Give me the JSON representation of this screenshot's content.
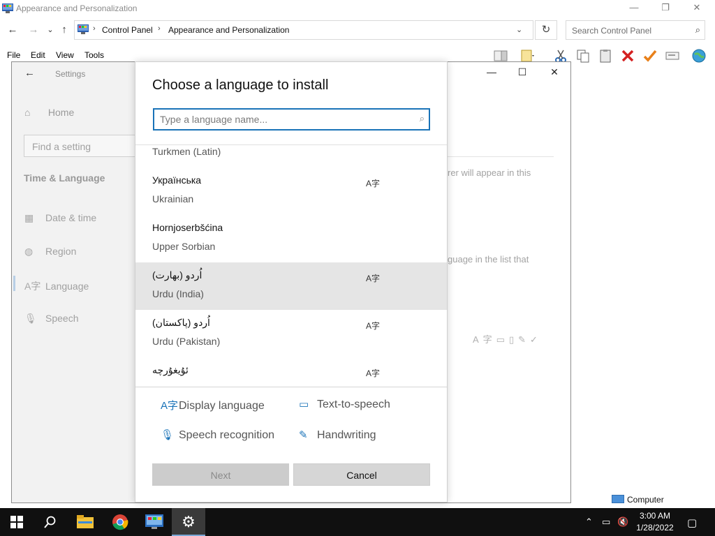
{
  "explorer": {
    "title": "Appearance and Personalization",
    "window_buttons": [
      "—",
      "❐",
      "✕"
    ],
    "nav": {
      "back": "←",
      "forward": "→",
      "recent": "⌄",
      "up": "↑"
    },
    "breadcrumb": [
      "Control Panel",
      "Appearance and Personalization"
    ],
    "breadcrumb_sep": "›",
    "address_dropdown": "⌄",
    "refresh": "↻",
    "search_placeholder": "Search Control Panel",
    "menu": [
      "File",
      "Edit",
      "View",
      "Tools"
    ]
  },
  "settings": {
    "title": "Settings",
    "back": "←",
    "home": "Home",
    "find_placeholder": "Find a setting",
    "section": "Time & Language",
    "nav": [
      {
        "label": "Date & time",
        "icon": "calendar-icon"
      },
      {
        "label": "Region",
        "icon": "globe-icon"
      },
      {
        "label": "Language",
        "icon": "language-icon"
      },
      {
        "label": "Speech",
        "icon": "microphone-icon"
      }
    ],
    "window_buttons": [
      "—",
      "☐",
      "✕"
    ],
    "bg_text_1": "rer will appear in this",
    "bg_text_2": "guage in the list that"
  },
  "dialog": {
    "title": "Choose a language to install",
    "search_placeholder": "Type a language name...",
    "languages": [
      {
        "native": "",
        "english": "Turkmen (Latin)",
        "display_language": false,
        "selected": false
      },
      {
        "native": "Українська",
        "english": "Ukrainian",
        "display_language": true,
        "selected": false
      },
      {
        "native": "Hornjoserbšćina",
        "english": "Upper Sorbian",
        "display_language": false,
        "selected": false
      },
      {
        "native": "اُردو (بھارت)",
        "english": "Urdu (India)",
        "display_language": true,
        "selected": true
      },
      {
        "native": "اُردو (پاکستان)",
        "english": "Urdu (Pakistan)",
        "display_language": true,
        "selected": false
      },
      {
        "native": "ئۇيغۇرچە",
        "english": "",
        "display_language": true,
        "selected": false
      }
    ],
    "feature_glyph": "A字",
    "legend": {
      "display_language": "Display language",
      "text_to_speech": "Text-to-speech",
      "speech_recognition": "Speech recognition",
      "handwriting": "Handwriting"
    },
    "buttons": {
      "next": "Next",
      "cancel": "Cancel"
    }
  },
  "statusbar": {
    "computer": "Computer"
  },
  "taskbar": {
    "time": "3:00 AM",
    "date": "1/28/2022",
    "pinned": [
      "start-icon",
      "search-icon",
      "file-explorer-icon",
      "chrome-icon",
      "control-panel-icon",
      "settings-icon"
    ]
  },
  "colors": {
    "accent": "#1a73b8",
    "selected_row": "#e5e5e5",
    "taskbar": "#101010"
  }
}
